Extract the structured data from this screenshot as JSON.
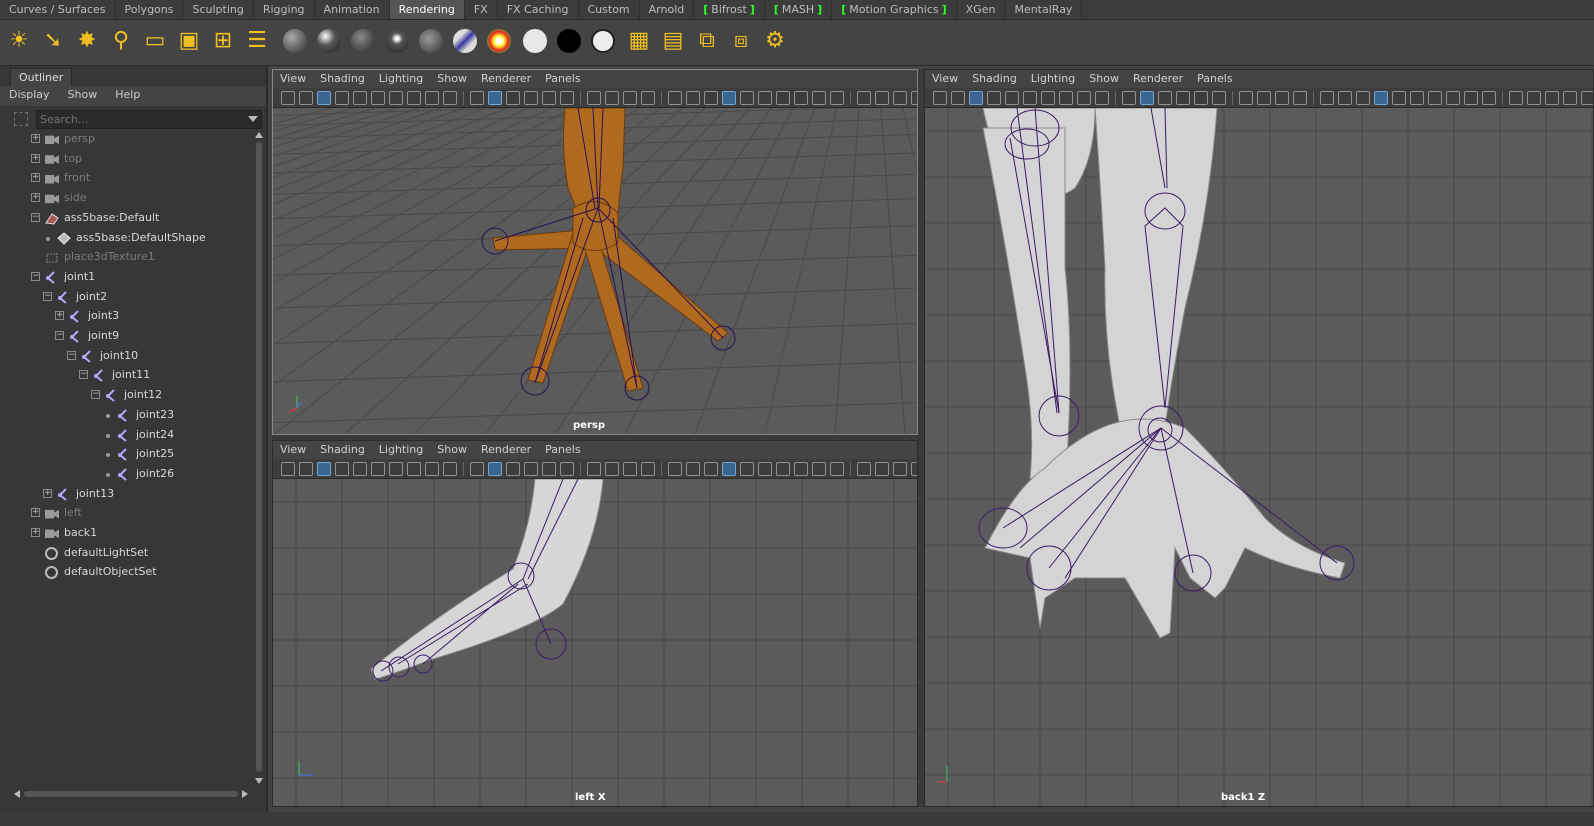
{
  "shelf_tabs": [
    "Curves / Surfaces",
    "Polygons",
    "Sculpting",
    "Rigging",
    "Animation",
    "Rendering",
    "FX",
    "FX Caching",
    "Custom",
    "Arnold",
    "Bifrost",
    "MASH",
    "Motion Graphics",
    "XGen",
    "MentalRay"
  ],
  "active_shelf_tab": "Rendering",
  "shelf_icons": [
    "ambient-light-icon",
    "directional-light-icon",
    "point-light-icon",
    "spot-light-icon",
    "area-light-icon",
    "volume-light-icon",
    "create-camera-icon",
    "render-settings-icon",
    "lambert-sphere-icon",
    "blinn-sphere-icon",
    "phong-sphere-icon",
    "phongE-sphere-icon",
    "anisotropic-sphere-icon",
    "layered-shader-icon",
    "ramp-shader-icon",
    "surface-white-icon",
    "surface-black-icon",
    "surface-outline-icon",
    "hypershade-icon",
    "render-view-icon",
    "ipr-render-icon",
    "render-sequence-icon",
    "batch-render-icon"
  ],
  "outliner": {
    "tab": "Outliner",
    "menus": [
      "Display",
      "Show",
      "Help"
    ],
    "search_placeholder": "Search...",
    "items": [
      {
        "label": "persp",
        "icon": "camera-icon",
        "dim": true
      },
      {
        "label": "top",
        "icon": "camera-icon",
        "dim": true
      },
      {
        "label": "front",
        "icon": "camera-icon",
        "dim": true
      },
      {
        "label": "side",
        "icon": "camera-icon",
        "dim": true
      },
      {
        "label": "ass5base:Default",
        "icon": "mesh-icon",
        "dim": false
      },
      {
        "label": "ass5base:DefaultShape",
        "icon": "shape-icon",
        "dim": false
      },
      {
        "label": "place3dTexture1",
        "icon": "texture-placement-icon",
        "dim": true
      },
      {
        "label": "joint1",
        "icon": "joint-icon",
        "dim": false
      },
      {
        "label": "joint2",
        "icon": "joint-icon",
        "dim": false
      },
      {
        "label": "joint3",
        "icon": "joint-icon",
        "dim": false
      },
      {
        "label": "joint9",
        "icon": "joint-icon",
        "dim": false
      },
      {
        "label": "joint10",
        "icon": "joint-icon",
        "dim": false
      },
      {
        "label": "joint11",
        "icon": "joint-icon",
        "dim": false
      },
      {
        "label": "joint12",
        "icon": "joint-icon",
        "dim": false
      },
      {
        "label": "joint23",
        "icon": "joint-icon",
        "dim": false
      },
      {
        "label": "joint24",
        "icon": "joint-icon",
        "dim": false
      },
      {
        "label": "joint25",
        "icon": "joint-icon",
        "dim": false
      },
      {
        "label": "joint26",
        "icon": "joint-icon",
        "dim": false
      },
      {
        "label": "joint13",
        "icon": "joint-icon",
        "dim": false
      },
      {
        "label": "left",
        "icon": "camera-icon",
        "dim": true
      },
      {
        "label": "back1",
        "icon": "camera-icon",
        "dim": false
      },
      {
        "label": "defaultLightSet",
        "icon": "set-icon",
        "dim": false
      },
      {
        "label": "defaultObjectSet",
        "icon": "set-icon",
        "dim": false
      }
    ]
  },
  "viewports": {
    "menus": [
      "View",
      "Shading",
      "Lighting",
      "Show",
      "Renderer",
      "Panels"
    ],
    "persp": {
      "label": "persp"
    },
    "left": {
      "label": "left X"
    },
    "back": {
      "label": "back1 Z"
    }
  },
  "colors": {
    "accent_bracket": "#2cff2c",
    "joint": "#3b1a66",
    "mesh_textured": "#b46a1e",
    "mesh_gray": "#d8d8d8",
    "viewport_bg": "#5b5b5b",
    "grid": "#4a4a4a"
  }
}
